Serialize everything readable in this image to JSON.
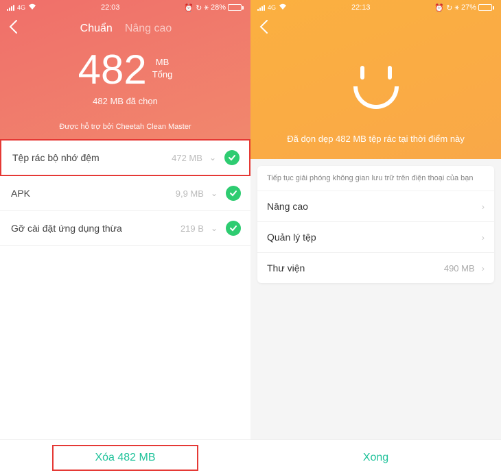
{
  "left": {
    "status": {
      "time": "22:03",
      "battery_pct": "28%",
      "battery_fill": 28
    },
    "tabs": {
      "active": "Chuẩn",
      "inactive": "Nâng cao"
    },
    "size_num": "482",
    "size_unit": "MB",
    "size_total": "Tổng",
    "selected": "482 MB đã chọn",
    "support": "Được hỗ trợ bởi Cheetah Clean Master",
    "items": [
      {
        "label": "Tệp rác bộ nhớ đệm",
        "size": "472 MB",
        "highlight": true
      },
      {
        "label": "APK",
        "size": "9,9 MB",
        "highlight": false
      },
      {
        "label": "Gỡ cài đặt ứng dụng thừa",
        "size": "219 B",
        "highlight": false
      }
    ],
    "footer": "Xóa 482 MB"
  },
  "right": {
    "status": {
      "time": "22:13",
      "battery_pct": "27%",
      "battery_fill": 27
    },
    "cleaned": "Đã dọn dẹp 482 MB tệp rác tại thời điểm này",
    "card_head": "Tiếp tục giải phóng không gian lưu trữ trên điện thoại của bạn",
    "rows": [
      {
        "label": "Nâng cao",
        "val": ""
      },
      {
        "label": "Quản lý tệp",
        "val": ""
      },
      {
        "label": "Thư viện",
        "val": "490 MB"
      }
    ],
    "footer": "Xong"
  }
}
